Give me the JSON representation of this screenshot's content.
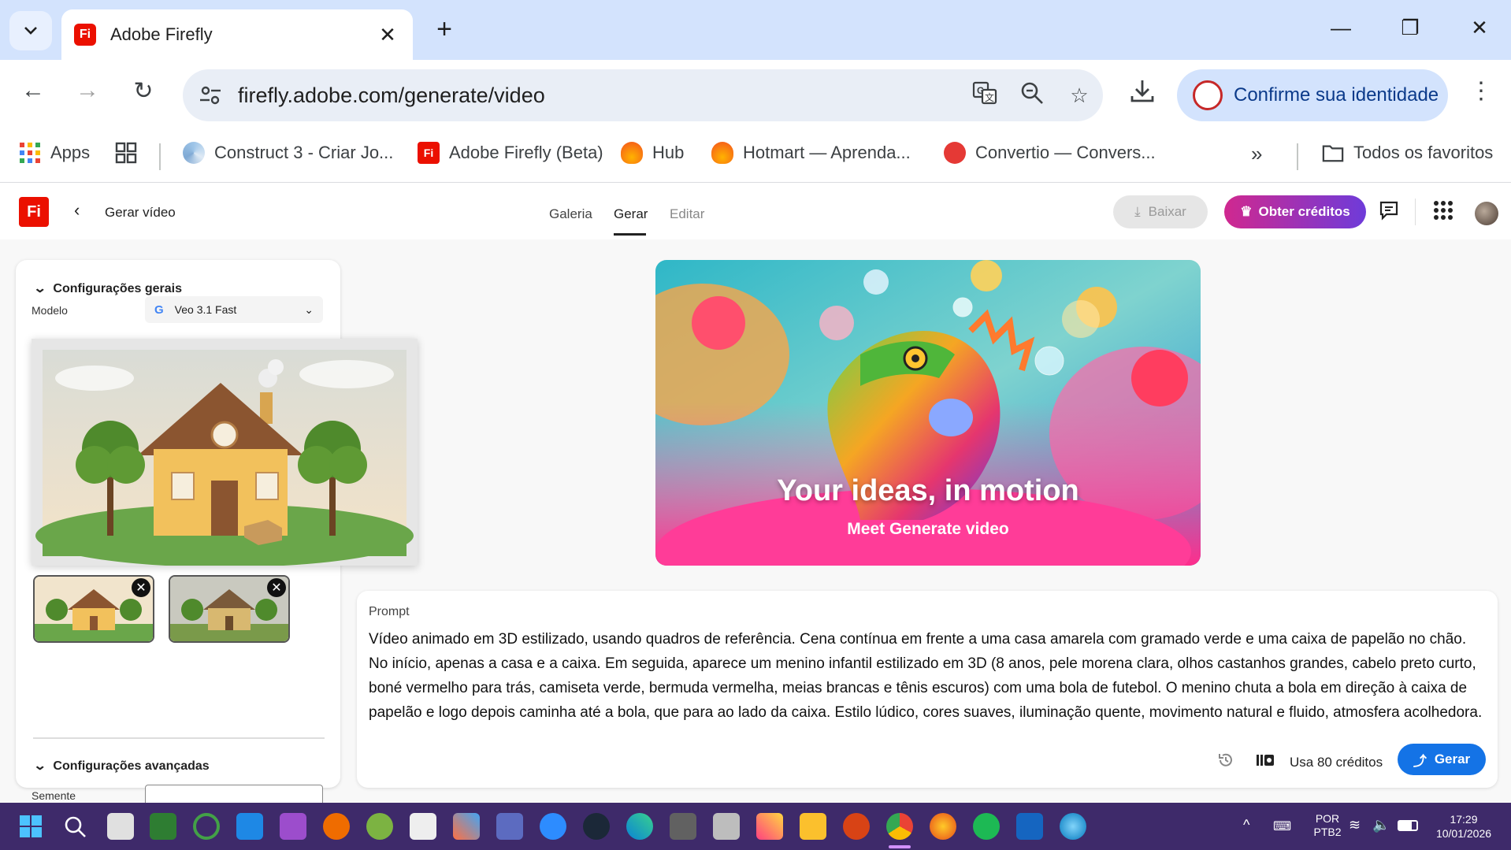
{
  "browser": {
    "tab_title": "Adobe Firefly",
    "url": "firefly.adobe.com/generate/video",
    "profile_label": "Confirme sua identidade"
  },
  "bookmarks": {
    "apps_label": "Apps",
    "items": [
      "Construct 3 - Criar Jo...",
      "Adobe Firefly (Beta)",
      "Hub",
      "Hotmart — Aprenda...",
      "Convertio — Convers..."
    ],
    "all_favorites": "Todos os favoritos"
  },
  "app": {
    "page_title": "Gerar vídeo",
    "tabs": [
      "Galeria",
      "Gerar",
      "Editar"
    ],
    "active_tab": "Gerar",
    "download_label": "Baixar",
    "credits_label": "Obter créditos"
  },
  "panel": {
    "general_settings": "Configurações gerais",
    "model_label": "Modelo",
    "model_value": "Veo 3.1 Fast",
    "advanced_settings": "Configurações avançadas",
    "seed_label": "Semente",
    "seed_value": ""
  },
  "hero": {
    "title": "Your ideas, in motion",
    "subtitle": "Meet Generate video"
  },
  "prompt": {
    "label": "Prompt",
    "text": "Vídeo animado em 3D estilizado, usando quadros de referência. Cena contínua em frente a uma casa amarela com gramado verde e uma caixa de papelão no chão. No início, apenas a casa e a caixa. Em seguida, aparece um menino infantil estilizado em 3D (8 anos, pele morena clara, olhos castanhos grandes, cabelo preto curto, boné vermelho para trás, camiseta verde, bermuda vermelha, meias brancas e tênis escuros) com uma bola de futebol. O menino chuta a bola em direção à caixa de papelão e logo depois caminha até a bola, que para ao lado da caixa. Estilo lúdico, cores suaves, iluminação quente, movimento natural e fluido, atmosfera acolhedora.",
    "credits_text": "Usa 80 créditos",
    "generate_label": "Gerar"
  },
  "taskbar": {
    "lang_top": "POR",
    "lang_bottom": "PTB2",
    "time": "17:29",
    "date": "10/01/2026"
  }
}
